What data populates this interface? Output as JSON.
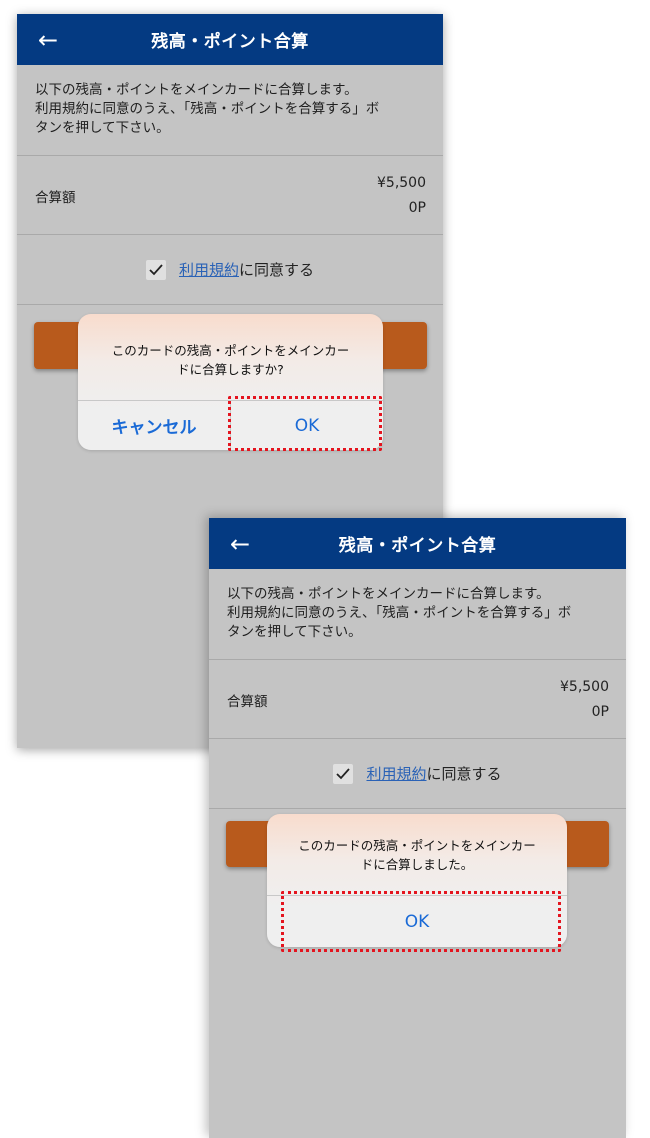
{
  "screen_top": {
    "title": "残高・ポイント合算",
    "back_icon": "←",
    "intro_lines": [
      "以下の残高・ポイントをメインカードに合算します。",
      "利用規約に同意のうえ、「残高・ポイントを合算する」ボ",
      "タンを押して下さい。"
    ],
    "amount_label": "合算額",
    "amount_yen": "¥5,500",
    "amount_points": "0P",
    "terms_link": "利用規約",
    "agree_suffix": "に同意する",
    "dialog": {
      "message_lines": [
        "このカードの残高・ポイントをメインカー",
        "ドに合算しますか?"
      ],
      "cancel_label": "キャンセル",
      "ok_label": "OK"
    }
  },
  "screen_bottom": {
    "title": "残高・ポイント合算",
    "back_icon": "←",
    "intro_lines": [
      "以下の残高・ポイントをメインカードに合算します。",
      "利用規約に同意のうえ、「残高・ポイントを合算する」ボ",
      "タンを押して下さい。"
    ],
    "amount_label": "合算額",
    "amount_yen": "¥5,500",
    "amount_points": "0P",
    "terms_link": "利用規約",
    "agree_suffix": "に同意する",
    "dialog": {
      "message_lines": [
        "このカードの残高・ポイントをメインカー",
        "ドに合算しました。"
      ],
      "ok_label": "OK"
    }
  },
  "colors": {
    "header": "#043a82",
    "overlay": "#c4c4c4",
    "accent_button": "#b85a1c",
    "dialog_button_text": "#1a6ad6",
    "highlight": "#e4141e",
    "link": "#2a62b6"
  }
}
